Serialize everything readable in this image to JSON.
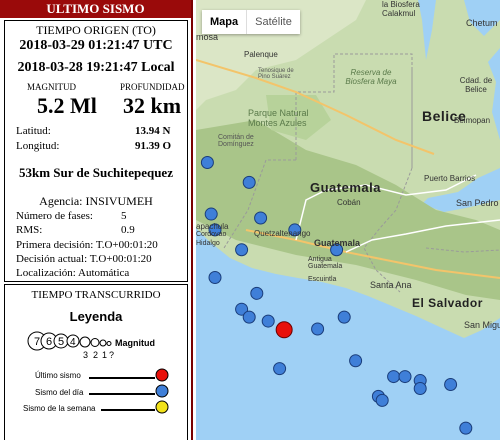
{
  "panel": {
    "header": "ULTIMO SISMO",
    "origin_title": "TIEMPO ORIGEN (TO)",
    "utc_time": "2018-03-29 01:21:47 UTC",
    "local_time": "2018-03-28 19:21:47 Local",
    "magnitude_label": "MAGNITUD",
    "depth_label": "PROFUNDIDAD",
    "magnitude_value": "5.2 Ml",
    "depth_value": "32 km",
    "latitude_label": "Latitud:",
    "latitude_value": "13.94 N",
    "longitude_label": "Longitud:",
    "longitude_value": "91.39 O",
    "location": "53km Sur de Suchitepequez",
    "agency": "Agencia: INSIVUMEH",
    "phases_label": "Número de fases:",
    "phases_value": "5",
    "rms_label": "RMS:",
    "rms_value": "0.9",
    "first_decision": "Primera decisión: T.O+00:01:20",
    "current_decision": "Decisión actual: T.O+00:01:20",
    "localization": "Localización: Automática",
    "elapsed_title": "TIEMPO TRANSCURRIDO"
  },
  "legend": {
    "title": "Leyenda",
    "magnitude_label": "Magnitud",
    "scale_numbers": [
      "7",
      "6",
      "5",
      "4",
      "3",
      "2",
      "1",
      "?"
    ],
    "last_quake_label": "Último sismo",
    "day_quake_label": "Sismo del día",
    "week_quake_label": "Sismo de la semana",
    "colors": {
      "last": "#e8100a",
      "day": "#3f7fd8",
      "week": "#f2e21a"
    }
  },
  "map": {
    "tab_map": "Mapa",
    "tab_satellite": "Satélite",
    "labels": {
      "belice": "Belice",
      "guatemala_country": "Guatemala",
      "el_salvador": "El Salvador",
      "guatemala_city": "Guatemala",
      "antigua": "Antigua Guatemala",
      "escuintla": "Escuintla",
      "santa_ana": "Santa Ana",
      "san_pedro": "San Pedro",
      "san_miguel": "San Miguel",
      "puerto_barrios": "Puerto Barrios",
      "coban": "Cobán",
      "palenque": "Palenque",
      "belmopan": "Belmopan",
      "chetumal": "Chetum",
      "la_biosfera": "la Biosfera",
      "calakmul": "Calakmul",
      "mosa": "mosa",
      "cdad_belice": "Cdad. de Belice",
      "reserva": "Reserva de Biosfera Maya",
      "tenosique": "Tenosique de Pino Suárez",
      "parque": "Parque Natural Montes Azules",
      "comitan": "Comitán de Domínguez",
      "quetzaltenango": "Quetzaltenango",
      "apachula": "apachula",
      "cordovao": "Cordovao",
      "hidalgo": "Hidalgo"
    },
    "roads": [
      "186",
      "199",
      "307",
      "CA13",
      "307",
      "CA1",
      "CA2",
      "CA9",
      "CA10",
      "CA11",
      "CA4",
      "CA5",
      "CA1"
    ],
    "epicenters_day": [
      {
        "lat": 16.05,
        "lon": -92.4
      },
      {
        "lat": 15.35,
        "lon": -91.7
      },
      {
        "lat": 15.8,
        "lon": -91.85
      },
      {
        "lat": 15.2,
        "lon": -91.25
      },
      {
        "lat": 14.95,
        "lon": -90.7
      },
      {
        "lat": 14.2,
        "lon": -91.95
      },
      {
        "lat": 14.1,
        "lon": -91.85
      },
      {
        "lat": 14.05,
        "lon": -91.6
      },
      {
        "lat": 14.1,
        "lon": -90.6
      },
      {
        "lat": 13.95,
        "lon": -90.95
      },
      {
        "lat": 13.45,
        "lon": -91.45
      },
      {
        "lat": 13.55,
        "lon": -90.45
      },
      {
        "lat": 13.35,
        "lon": -89.95
      },
      {
        "lat": 13.35,
        "lon": -89.8
      },
      {
        "lat": 13.3,
        "lon": -89.6
      },
      {
        "lat": 13.2,
        "lon": -89.6
      },
      {
        "lat": 13.1,
        "lon": -90.15
      },
      {
        "lat": 13.05,
        "lon": -90.1
      },
      {
        "lat": 13.25,
        "lon": -89.2
      },
      {
        "lat": 12.7,
        "lon": -89.0
      },
      {
        "lat": 15.2,
        "lon": -92.3
      },
      {
        "lat": 15.4,
        "lon": -92.35
      },
      {
        "lat": 14.6,
        "lon": -92.3
      },
      {
        "lat": 14.95,
        "lon": -91.95
      },
      {
        "lat": 14.4,
        "lon": -91.75
      }
    ],
    "epicenter_last": {
      "lat": 13.94,
      "lon": -91.39
    }
  }
}
